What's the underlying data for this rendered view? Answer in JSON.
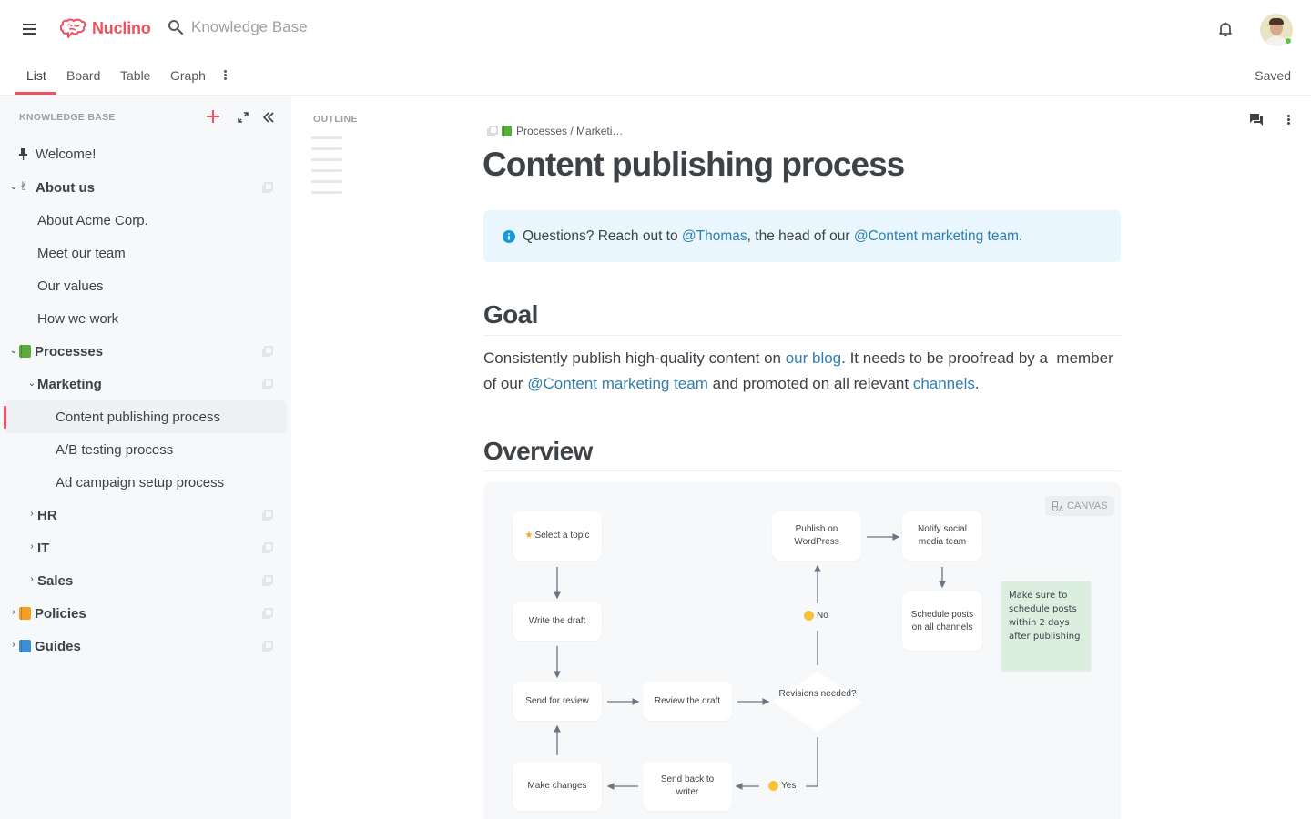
{
  "app": {
    "name": "Nuclino",
    "brand_color": "#f0505f",
    "search_placeholder": "Knowledge Base",
    "save_status": "Saved"
  },
  "view_tabs": [
    {
      "label": "List",
      "active": true
    },
    {
      "label": "Board",
      "active": false
    },
    {
      "label": "Table",
      "active": false
    },
    {
      "label": "Graph",
      "active": false
    }
  ],
  "sidebar": {
    "header": "KNOWLEDGE BASE",
    "items": [
      {
        "label": "Welcome!",
        "icon": "pin-icon",
        "level": 0,
        "bold": false
      },
      {
        "label": "About us",
        "icon": "victory-hand-emoji",
        "level": 0,
        "bold": true,
        "expanded": true
      },
      {
        "label": "About Acme Corp.",
        "level": 1,
        "bold": false
      },
      {
        "label": "Meet our team",
        "level": 1,
        "bold": false
      },
      {
        "label": "Our values",
        "level": 1,
        "bold": false
      },
      {
        "label": "How we work",
        "level": 1,
        "bold": false
      },
      {
        "label": "Processes",
        "icon": "green-book-emoji",
        "level": 0,
        "bold": true,
        "expanded": true
      },
      {
        "label": "Marketing",
        "level": 1,
        "bold": true,
        "expanded": true
      },
      {
        "label": "Content publishing process",
        "level": 2,
        "bold": false,
        "selected": true
      },
      {
        "label": "A/B testing process",
        "level": 2,
        "bold": false
      },
      {
        "label": "Ad campaign setup process",
        "level": 2,
        "bold": false
      },
      {
        "label": "HR",
        "level": 1,
        "bold": true,
        "expanded": false
      },
      {
        "label": "IT",
        "level": 1,
        "bold": true,
        "expanded": false
      },
      {
        "label": "Sales",
        "level": 1,
        "bold": true,
        "expanded": false
      },
      {
        "label": "Policies",
        "icon": "orange-book-emoji",
        "level": 0,
        "bold": true,
        "expanded": false
      },
      {
        "label": "Guides",
        "icon": "blue-book-emoji",
        "level": 0,
        "bold": true,
        "expanded": false
      }
    ]
  },
  "outline": {
    "label": "OUTLINE"
  },
  "document": {
    "breadcrumb": "Processes / Marketi…",
    "title": "Content publishing process",
    "callout": {
      "prefix": "Questions? Reach out to ",
      "mention1": "@Thomas",
      "middle": ", the head of our ",
      "mention2": "@Content marketing team",
      "suffix": ".",
      "bg_color": "#e9f6fd"
    },
    "goal_heading": "Goal",
    "goal_paragraph": {
      "t1": "Consistently publish high-quality content on ",
      "link1": "our blog",
      "t2": ". It needs to be proofread by a  member of our ",
      "link2": "@Content marketing team",
      "t3": " and promoted on all relevant ",
      "link3": "channels",
      "t4": "."
    },
    "overview_heading": "Overview",
    "link_color": "#2e7fb0"
  },
  "canvas": {
    "badge": "CANVAS",
    "nodes": {
      "select_topic": "Select a topic",
      "write_draft": "Write the draft",
      "send_review": "Send for review",
      "review_draft": "Review the draft",
      "revisions": "Revisions needed?",
      "make_changes": "Make changes",
      "send_back": "Send back to writer",
      "publish": "Publish on WordPress",
      "notify": "Notify social media team",
      "schedule": "Schedule posts on all channels"
    },
    "edge_labels": {
      "no": "No",
      "yes": "Yes"
    },
    "sticky_note": "Make sure to schedule posts within 2 days after publishing",
    "sticky_color": "#dcefdf"
  }
}
